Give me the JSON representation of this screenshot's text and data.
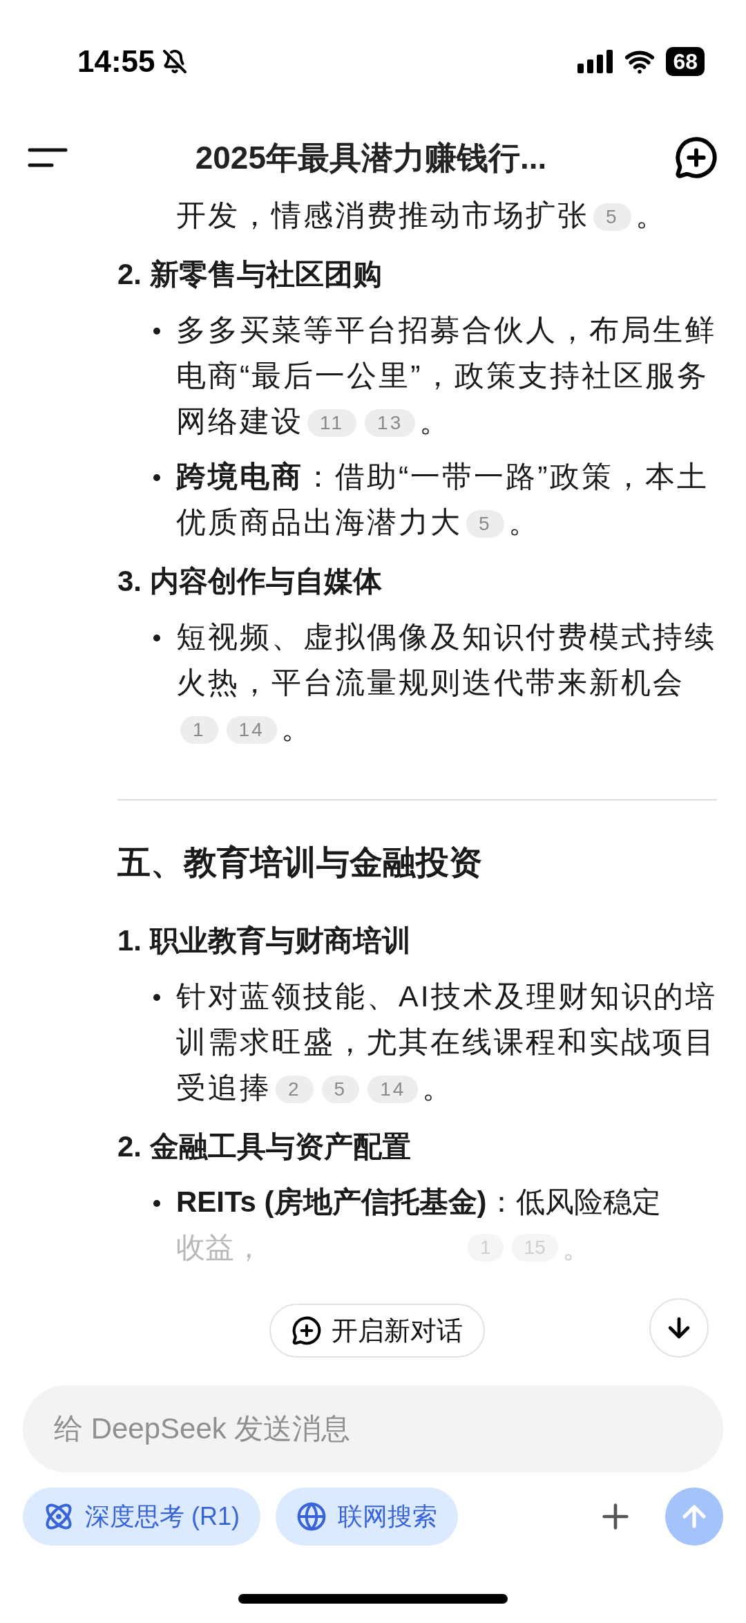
{
  "status_bar": {
    "time": "14:55",
    "battery": "68"
  },
  "header": {
    "title": "2025年最具潜力赚钱行..."
  },
  "blocks": [
    {
      "kind": "continuation",
      "text": "开发，情感消费推动市场扩张",
      "citations": [
        "5"
      ],
      "end": "。"
    },
    {
      "kind": "numbered",
      "text": "2. 新零售与社区团购"
    },
    {
      "kind": "bullet",
      "text": "多多买菜等平台招募合伙人，布局生鲜电商“最后一公里”，政策支持社区服务网络建设",
      "citations": [
        "11",
        "13"
      ],
      "end": "。"
    },
    {
      "kind": "bullet",
      "lead": "跨境电商",
      "text": "：借助“一带一路”政策，本土优质商品出海潜力大",
      "citations": [
        "5"
      ],
      "end": "。"
    },
    {
      "kind": "numbered",
      "text": "3. 内容创作与自媒体"
    },
    {
      "kind": "bullet",
      "text": "短视频、虚拟偶像及知识付费模式持续火热，平台流量规则迭代带来新机会",
      "citations": [
        "1",
        "14"
      ],
      "end": "。"
    },
    {
      "kind": "divider"
    },
    {
      "kind": "section",
      "text": "五、教育培训与金融投资"
    },
    {
      "kind": "numbered",
      "text": "1. 职业教育与财商培训"
    },
    {
      "kind": "bullet",
      "text": "针对蓝领技能、AI技术及理财知识的培训需求旺盛，尤其在线课程和实战项目受追捧",
      "citations": [
        "2",
        "5",
        "14"
      ],
      "end": "。"
    },
    {
      "kind": "numbered",
      "text": "2. 金融工具与资产配置"
    },
    {
      "kind": "covered",
      "lead": "REITs (房地产信托基金)",
      "text": "：低风险稳定",
      "tail": "收益，",
      "citations": [
        "1",
        "15"
      ],
      "end": "。"
    }
  ],
  "new_chat_button": {
    "label": "开启新对话"
  },
  "composer": {
    "placeholder": "给 DeepSeek 发送消息"
  },
  "toggles": [
    {
      "kind": "deepthink",
      "label": "深度思考 (R1)",
      "selected": true
    },
    {
      "kind": "search",
      "label": "联网搜索",
      "selected": true
    }
  ],
  "send_button": {
    "disabled": true
  }
}
